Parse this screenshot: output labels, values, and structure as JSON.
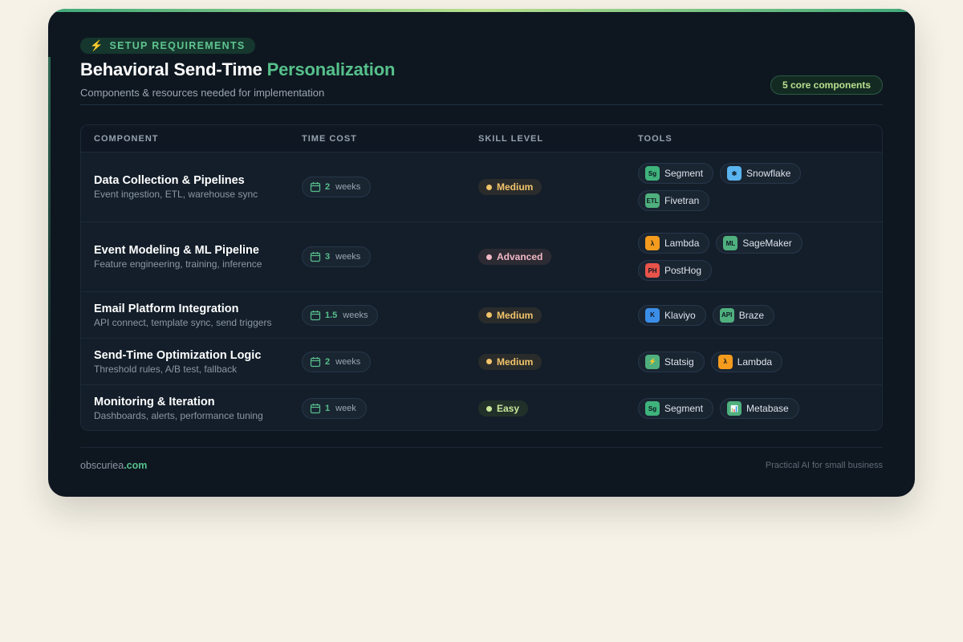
{
  "header": {
    "eyebrow": "SETUP REQUIREMENTS",
    "title_main": "Behavioral Send-Time",
    "title_accent": "Personalization",
    "subtitle": "Components & resources needed for implementation",
    "count_badge": "5 core components"
  },
  "table": {
    "columns": [
      "COMPONENT",
      "TIME COST",
      "SKILL LEVEL",
      "TOOLS"
    ],
    "rows": [
      {
        "name": "Data Collection & Pipelines",
        "desc": "Event ingestion, ETL, warehouse sync",
        "time_value": "2",
        "time_unit": "weeks",
        "skill": "Medium",
        "tools": [
          {
            "label": "Segment",
            "abbr": "Sg",
            "icon": "segment-icon",
            "color": "#3fb37c"
          },
          {
            "label": "Snowflake",
            "abbr": "❄",
            "icon": "snowflake-icon",
            "color": "#5ab4ef"
          },
          {
            "label": "Fivetran",
            "abbr": "ETL",
            "icon": "fivetran-icon",
            "color": "#4fb07e"
          }
        ]
      },
      {
        "name": "Event Modeling & ML Pipeline",
        "desc": "Feature engineering, training, inference",
        "time_value": "3",
        "time_unit": "weeks",
        "skill": "Advanced",
        "tools": [
          {
            "label": "Lambda",
            "abbr": "λ",
            "icon": "lambda-icon",
            "color": "#f59b1d"
          },
          {
            "label": "SageMaker",
            "abbr": "ML",
            "icon": "sagemaker-icon",
            "color": "#4fb07e"
          },
          {
            "label": "PostHog",
            "abbr": "PH",
            "icon": "posthog-icon",
            "color": "#e8534a"
          }
        ]
      },
      {
        "name": "Email Platform Integration",
        "desc": "API connect, template sync, send triggers",
        "time_value": "1.5",
        "time_unit": "weeks",
        "skill": "Medium",
        "tools": [
          {
            "label": "Klaviyo",
            "abbr": "K",
            "icon": "klaviyo-icon",
            "color": "#3b8ee8"
          },
          {
            "label": "Braze",
            "abbr": "API",
            "icon": "braze-icon",
            "color": "#4fb07e"
          }
        ]
      },
      {
        "name": "Send-Time Optimization Logic",
        "desc": "Threshold rules, A/B test, fallback",
        "time_value": "2",
        "time_unit": "weeks",
        "skill": "Medium",
        "tools": [
          {
            "label": "Statsig",
            "abbr": "⚡",
            "icon": "statsig-icon",
            "color": "#4fb07e"
          },
          {
            "label": "Lambda",
            "abbr": "λ",
            "icon": "lambda-icon",
            "color": "#f59b1d"
          }
        ]
      },
      {
        "name": "Monitoring & Iteration",
        "desc": "Dashboards, alerts, performance tuning",
        "time_value": "1",
        "time_unit": "week",
        "skill": "Easy",
        "tools": [
          {
            "label": "Segment",
            "abbr": "Sg",
            "icon": "segment-icon",
            "color": "#3fb37c"
          },
          {
            "label": "Metabase",
            "abbr": "📊",
            "icon": "metabase-icon",
            "color": "#4fb07e"
          }
        ]
      }
    ]
  },
  "footer": {
    "brand_name": "obscuriea",
    "brand_tld": ".com",
    "tagline": "Practical AI for small business"
  }
}
